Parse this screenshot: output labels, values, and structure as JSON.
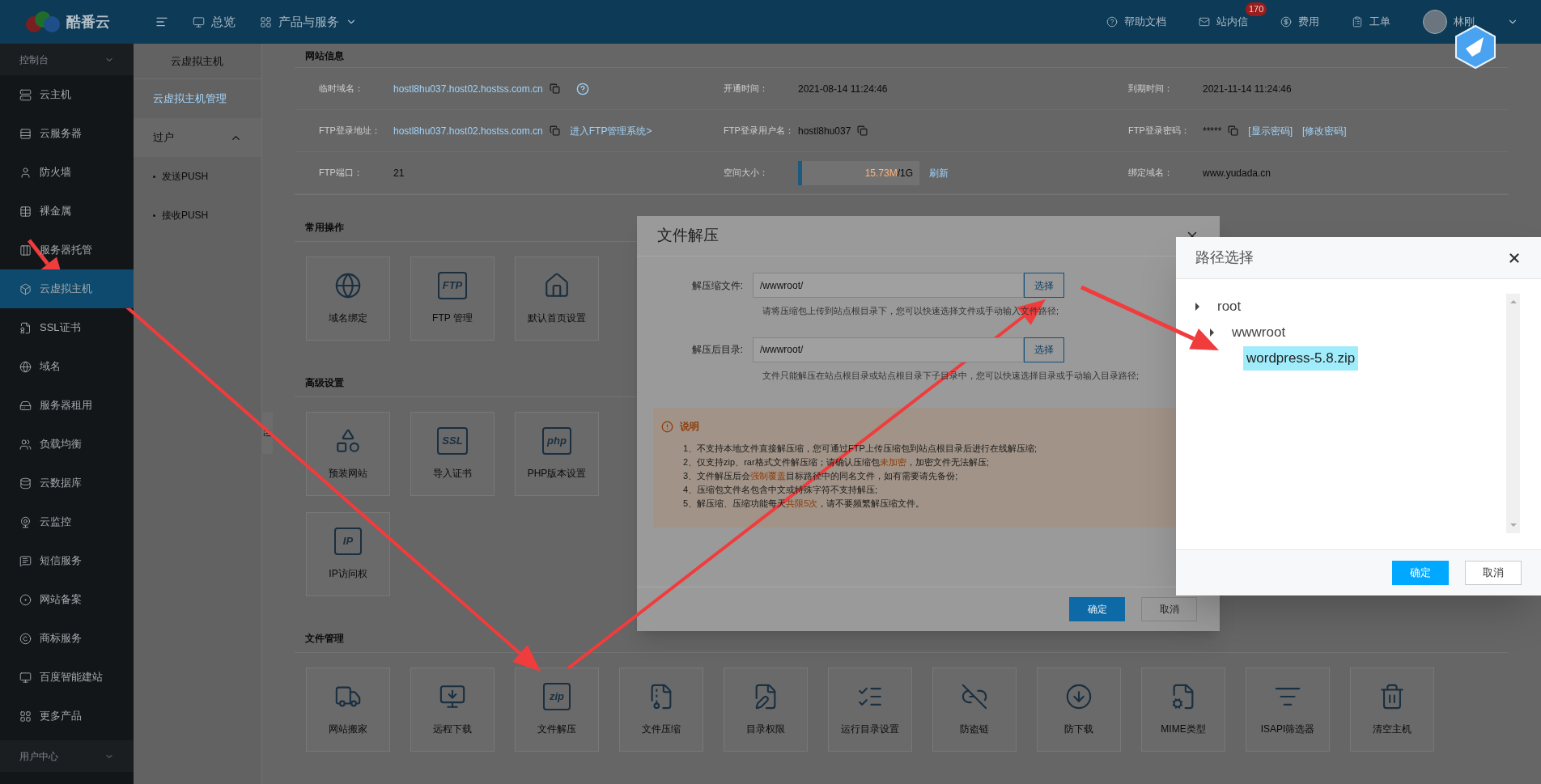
{
  "top_bar": {
    "logo": "酷番云",
    "nav": [
      {
        "label": "总览",
        "kind": "monitor"
      },
      {
        "label": "产品与服务",
        "kind": "grid"
      }
    ],
    "right": [
      {
        "label": "帮助文档",
        "kind": "help"
      },
      {
        "label": "站内信",
        "kind": "mail",
        "badge": "170"
      },
      {
        "label": "费用",
        "kind": "coin"
      },
      {
        "label": "工单",
        "kind": "list"
      }
    ],
    "user": "林刚"
  },
  "sidebar": {
    "header": "控制台",
    "footer": "用户中心",
    "items": [
      {
        "label": "云主机",
        "selected": false
      },
      {
        "label": "云服务器",
        "selected": false
      },
      {
        "label": "防火墙",
        "selected": false
      },
      {
        "label": "裸金属",
        "selected": false
      },
      {
        "label": "服务器托管",
        "selected": false
      },
      {
        "label": "云虚拟主机",
        "selected": true
      },
      {
        "label": "SSL证书",
        "selected": false
      },
      {
        "label": "域名",
        "selected": false
      },
      {
        "label": "服务器租用",
        "selected": false
      },
      {
        "label": "负载均衡",
        "selected": false
      },
      {
        "label": "云数据库",
        "selected": false
      },
      {
        "label": "云监控",
        "selected": false
      },
      {
        "label": "短信服务",
        "selected": false
      },
      {
        "label": "网站备案",
        "selected": false
      },
      {
        "label": "商标服务",
        "selected": false
      },
      {
        "label": "百度智能建站",
        "selected": false
      },
      {
        "label": "更多产品",
        "selected": false
      }
    ]
  },
  "subnav": {
    "title": "云虚拟主机",
    "items": [
      {
        "label": "云虚拟主机管理",
        "selected": true
      }
    ],
    "group": {
      "label": "过户",
      "expanded": true,
      "children": [
        "发送PUSH",
        "接收PUSH"
      ]
    }
  },
  "site_info": {
    "title": "网站信息",
    "rows": [
      [
        {
          "label": "临时域名：",
          "value": "hostl8hu037.host02.hostss.com.cn",
          "kind": "link",
          "copy": true,
          "help": true
        },
        {
          "label": "开通时间：",
          "value": "2021-08-14 11:24:46",
          "kind": "text",
          "copy": false
        },
        {
          "label": "到期时间：",
          "value": "2021-11-14 11:24:46",
          "kind": "text",
          "copy": false
        }
      ],
      [
        {
          "label": "FTP登录地址：",
          "value": "hostl8hu037.host02.hostss.com.cn",
          "kind": "link",
          "copy": true,
          "links": [
            "进入FTP管理系统>"
          ]
        },
        {
          "label": "FTP登录用户名：",
          "value": "hostl8hu037",
          "kind": "text",
          "copy": true
        },
        {
          "label": "FTP登录密码：",
          "value": "*****",
          "kind": "text",
          "copy": true,
          "links": [
            "[显示密码]",
            "[修改密码]"
          ]
        }
      ],
      [
        {
          "label": "FTP端口：",
          "value": "21",
          "kind": "text",
          "copy": false
        },
        {
          "label": "空间大小：",
          "kind": "usage",
          "used": "15.73M",
          "total": "/1G",
          "level": 0.02,
          "links": [
            "刷新"
          ]
        },
        {
          "label": "绑定域名：",
          "value": "www.yudada.cn",
          "kind": "text",
          "copy": false
        }
      ]
    ]
  },
  "sections": [
    {
      "title": "常用操作",
      "tiles": [
        {
          "label": "域名绑定"
        },
        {
          "label": "FTP 管理",
          "icon_text": "FTP"
        },
        {
          "label": "默认首页设置"
        }
      ]
    },
    {
      "title": "高级设置",
      "tiles": [
        {
          "label": "预装网站"
        },
        {
          "label": "导入证书",
          "icon_text": "SSL"
        },
        {
          "label": "PHP版本设置",
          "icon_text": "php"
        },
        {
          "label": "IP访问权",
          "icon_text": "IP"
        }
      ]
    },
    {
      "title": "文件管理",
      "tiles": [
        {
          "label": "网站搬家"
        },
        {
          "label": "远程下载"
        },
        {
          "label": "文件解压",
          "icon_text": "zip"
        },
        {
          "label": "文件压缩"
        },
        {
          "label": "目录权限"
        },
        {
          "label": "运行目录设置"
        },
        {
          "label": "防盗链"
        },
        {
          "label": "防下载"
        },
        {
          "label": "MIME类型"
        },
        {
          "label": "ISAPI筛选器"
        },
        {
          "label": "清空主机"
        }
      ]
    }
  ],
  "unzip_dialog": {
    "title": "文件解压",
    "fields": [
      {
        "label": "解压缩文件:",
        "value": "/wwwroot/",
        "button": "选择",
        "hint": "请将压缩包上传到站点根目录下，您可以快速选择文件或手动输入文件路径;"
      },
      {
        "label": "解压后目录:",
        "value": "/wwwroot/",
        "button": "选择",
        "hint": "文件只能解压在站点根目录或站点根目录下子目录中，您可以快速选择目录或手动输入目录路径;"
      }
    ],
    "notice": {
      "title": "说明",
      "items": [
        "1、不支持本地文件直接解压缩，您可通过FTP上传压缩包到站点根目录后进行在线解压缩;",
        "2、仅支持zip、rar格式文件解压缩；请确认压缩包**未加密**，加密文件无法解压;",
        "3、文件解压后会**强制覆盖**目标路径中的同名文件，如有需要请先备份;",
        "4、压缩包文件名包含中文或特殊字符不支持解压;",
        "5、解压缩、压缩功能每天**共限5次**，请不要频繁解压缩文件。"
      ]
    },
    "buttons": [
      "确定",
      "取消"
    ]
  },
  "path_dialog": {
    "title": "路径选择",
    "tree": [
      {
        "label": "root",
        "selected": false,
        "children": [
          {
            "label": "wwwroot",
            "selected": false,
            "children": [
              {
                "label": "wordpress-5.8.zip",
                "selected": true
              }
            ]
          }
        ]
      }
    ],
    "buttons": [
      "确定",
      "取消"
    ]
  }
}
